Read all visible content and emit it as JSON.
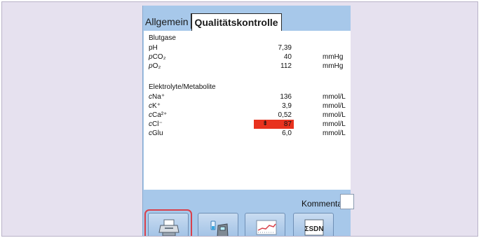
{
  "tabs": [
    {
      "label": "Allgemein",
      "active": false
    },
    {
      "label": "Qualitätskontrolle",
      "active": true
    }
  ],
  "sections": [
    {
      "title": "Blutgase",
      "rows": [
        {
          "prefix": "",
          "name": "pH",
          "value": "7,39",
          "unit": ""
        },
        {
          "prefix": "p",
          "name": "CO₂",
          "value": "40",
          "unit": "mmHg"
        },
        {
          "prefix": "p",
          "name": "O₂",
          "value": "112",
          "unit": "mmHg"
        }
      ]
    },
    {
      "title": "Elektrolyte/Metabolite",
      "rows": [
        {
          "prefix": "c",
          "name": "Na⁺",
          "value": "136",
          "unit": "mmol/L"
        },
        {
          "prefix": "c",
          "name": "K⁺",
          "value": "3,9",
          "unit": "mmol/L"
        },
        {
          "prefix": "c",
          "name": "Ca²⁺",
          "value": "0,52",
          "unit": "mmol/L"
        },
        {
          "prefix": "c",
          "name": "Cl⁻",
          "value": "87",
          "unit": "mmol/L",
          "flag": "low",
          "flag_symbol": "⇟"
        },
        {
          "prefix": "c",
          "name": "Glu",
          "value": "6,0",
          "unit": "mmol/L"
        }
      ]
    }
  ],
  "comment": {
    "label": "Kommentar",
    "value": ""
  },
  "toolbar": {
    "buttons": [
      {
        "icon": "printer-icon",
        "selected": true
      },
      {
        "icon": "analyzer-icon",
        "selected": false
      },
      {
        "icon": "trend-chart-icon",
        "selected": false
      },
      {
        "icon": "statistics-icon",
        "selected": false,
        "icon_text": "ΣSDN"
      }
    ]
  },
  "colors": {
    "flag_low": "#e8321e",
    "panel": "#a7c8ea",
    "highlight_ring": "#d9404a"
  }
}
